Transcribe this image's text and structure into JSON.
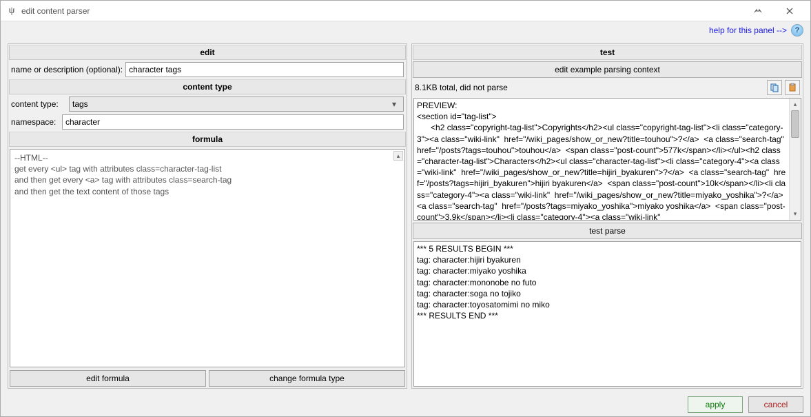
{
  "window": {
    "title": "edit content parser"
  },
  "helpbar": {
    "link": "help for this panel -->"
  },
  "left": {
    "header_edit": "edit",
    "name_label": "name or description (optional):",
    "name_value": "character tags",
    "header_content_type": "content type",
    "content_type_label": "content type:",
    "content_type_value": "tags",
    "namespace_label": "namespace:",
    "namespace_value": "character",
    "header_formula": "formula",
    "formula_lines": [
      "--HTML--",
      "get every <ul> tag with attributes class=character-tag-list",
      "and then get every <a> tag with attributes class=search-tag",
      "and then get the text content of those tags"
    ],
    "edit_formula_btn": "edit formula",
    "change_formula_type_btn": "change formula type"
  },
  "right": {
    "header_test": "test",
    "edit_context_btn": "edit example parsing context",
    "status": "8.1KB total, did not parse",
    "preview_text": "PREVIEW:\n<section id=\"tag-list\">\n      <h2 class=\"copyright-tag-list\">Copyrights</h2><ul class=\"copyright-tag-list\"><li class=\"category-3\"><a class=\"wiki-link\"  href=\"/wiki_pages/show_or_new?title=touhou\">?</a>  <a class=\"search-tag\"  href=\"/posts?tags=touhou\">touhou</a>  <span class=\"post-count\">577k</span></li></ul><h2 class=\"character-tag-list\">Characters</h2><ul class=\"character-tag-list\"><li class=\"category-4\"><a class=\"wiki-link\"  href=\"/wiki_pages/show_or_new?title=hijiri_byakuren\">?</a>  <a class=\"search-tag\"  href=\"/posts?tags=hijiri_byakuren\">hijiri byakuren</a>  <span class=\"post-count\">10k</span></li><li class=\"category-4\"><a class=\"wiki-link\"  href=\"/wiki_pages/show_or_new?title=miyako_yoshika\">?</a>  <a class=\"search-tag\"  href=\"/posts?tags=miyako_yoshika\">miyako yoshika</a>  <span class=\"post-count\">3.9k</span></li><li class=\"category-4\"><a class=\"wiki-link\"",
    "test_parse_btn": "test parse",
    "results_text": "*** 5 RESULTS BEGIN ***\ntag: character:hijiri byakuren\ntag: character:miyako yoshika\ntag: character:mononobe no futo\ntag: character:soga no tojiko\ntag: character:toyosatomimi no miko\n*** RESULTS END ***"
  },
  "footer": {
    "apply": "apply",
    "cancel": "cancel"
  }
}
